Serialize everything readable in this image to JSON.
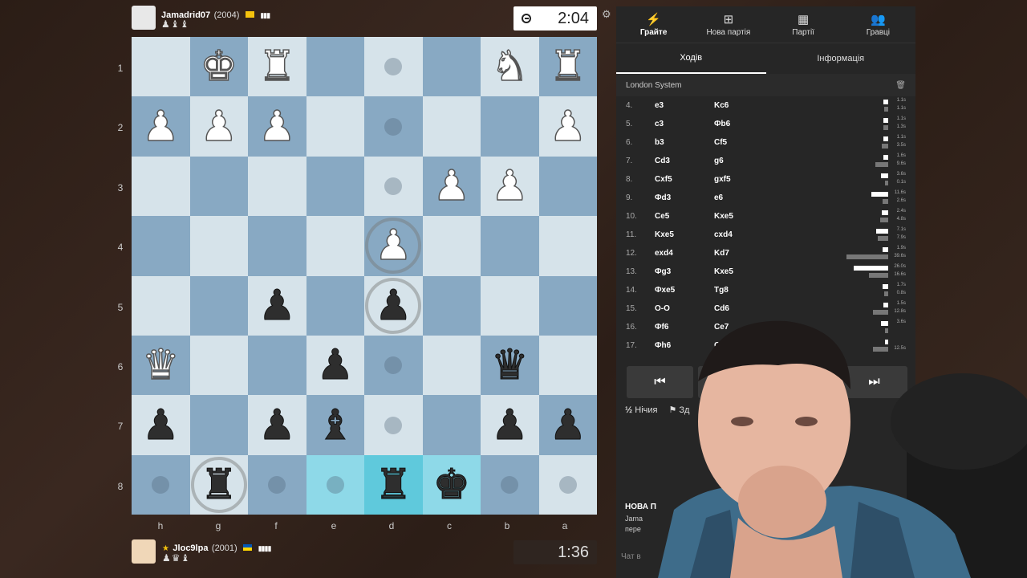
{
  "top_player": {
    "name": "Jamadrid07",
    "rating": "(2004)",
    "captured": "♟♝♝",
    "flag": "#f4c20d"
  },
  "bottom_player": {
    "name": "Jloc9lpa",
    "rating": "(2001)",
    "captured": "♟♛♝",
    "flag": "#0057b7"
  },
  "top_clock": {
    "time": "2:04"
  },
  "bottom_clock": {
    "time": "1:36"
  },
  "ranks": [
    "1",
    "2",
    "3",
    "4",
    "5",
    "6",
    "7",
    "8"
  ],
  "files": [
    "h",
    "g",
    "f",
    "e",
    "d",
    "c",
    "b",
    "a"
  ],
  "nav": {
    "play": "Грайте",
    "new_game": "Нова партія",
    "games": "Партії",
    "players": "Гравці"
  },
  "tabs": {
    "moves": "Ходів",
    "info": "Інформація"
  },
  "opening": "London System",
  "moves": [
    {
      "n": "4.",
      "w": "e3",
      "b": "Kc6",
      "tw": "1.1s",
      "tb": "1.1s"
    },
    {
      "n": "5.",
      "w": "c3",
      "b": "Фb6",
      "tw": "1.1s",
      "tb": "1.3s"
    },
    {
      "n": "6.",
      "w": "b3",
      "b": "Cf5",
      "tw": "1.1s",
      "tb": "3.5s"
    },
    {
      "n": "7.",
      "w": "Cd3",
      "b": "g6",
      "tw": "1.6s",
      "tb": "9.6s"
    },
    {
      "n": "8.",
      "w": "Cxf5",
      "b": "gxf5",
      "tw": "3.6s",
      "tb": "0.1s"
    },
    {
      "n": "9.",
      "w": "Фd3",
      "b": "e6",
      "tw": "11.6s",
      "tb": "2.6s"
    },
    {
      "n": "10.",
      "w": "Ce5",
      "b": "Kxe5",
      "tw": "2.4s",
      "tb": "4.8s"
    },
    {
      "n": "11.",
      "w": "Kxe5",
      "b": "cxd4",
      "tw": "7.1s",
      "tb": "7.9s"
    },
    {
      "n": "12.",
      "w": "exd4",
      "b": "Kd7",
      "tw": "1.9s",
      "tb": "39.6s"
    },
    {
      "n": "13.",
      "w": "Фg3",
      "b": "Kxe5",
      "tw": "26.0s",
      "tb": "16.6s"
    },
    {
      "n": "14.",
      "w": "Фxe5",
      "b": "Tg8",
      "tw": "1.7s",
      "tb": "0.8s"
    },
    {
      "n": "15.",
      "w": "O-O",
      "b": "Cd6",
      "tw": "1.5s",
      "tb": "12.8s"
    },
    {
      "n": "16.",
      "w": "Фf6",
      "b": "Ce7",
      "tw": "3.6s",
      "tb": ""
    },
    {
      "n": "17.",
      "w": "Фh6",
      "b": "O-O",
      "tw": "",
      "tb": "12.5s"
    }
  ],
  "actions": {
    "draw": "Нічия",
    "resign": "Зд"
  },
  "new_game_title": "НОВА П",
  "new_game_sub1": "Jama",
  "new_game_sub2": "пере",
  "chat_placeholder": "Чат в"
}
